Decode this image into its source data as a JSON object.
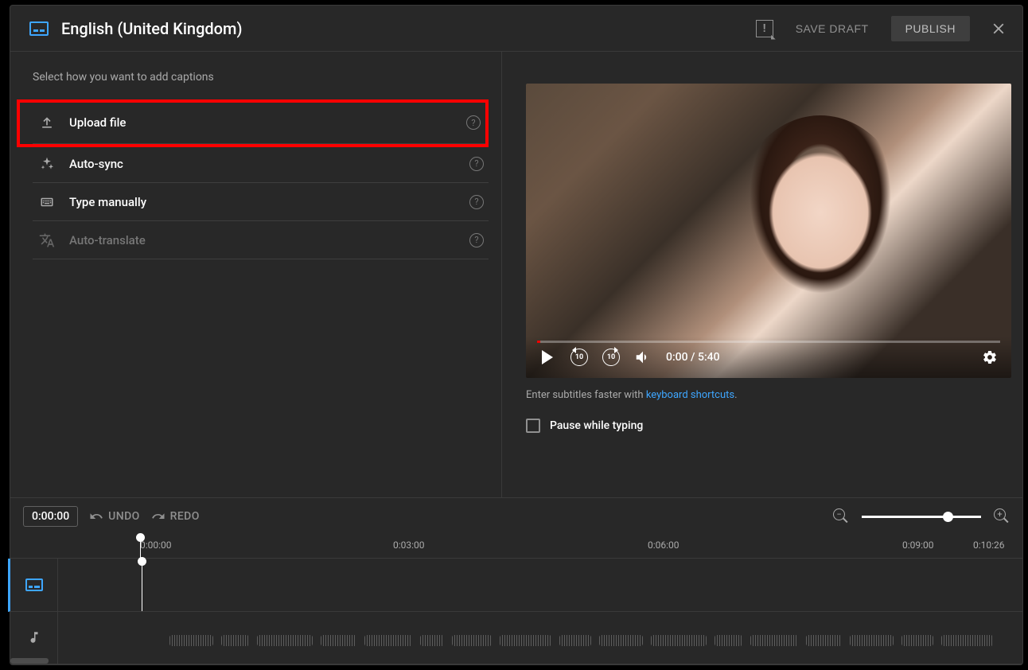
{
  "header": {
    "title": "English (United Kingdom)",
    "save_draft": "SAVE DRAFT",
    "publish": "PUBLISH"
  },
  "left": {
    "hint": "Select how you want to add captions",
    "options": {
      "upload": "Upload file",
      "autosync": "Auto-sync",
      "manual": "Type manually",
      "translate": "Auto-translate"
    }
  },
  "video": {
    "skip_back": "10",
    "skip_fwd": "10",
    "time": "0:00 / 5:40"
  },
  "right": {
    "hint_prefix": "Enter subtitles faster with ",
    "hint_link": "keyboard shortcuts",
    "hint_suffix": ".",
    "pause_label": "Pause while typing"
  },
  "timeline": {
    "current": "0:00:00",
    "undo": "UNDO",
    "redo": "REDO",
    "ticks": [
      "0:00:00",
      "0:03:00",
      "0:06:00",
      "0:09:00",
      "0:10:26"
    ]
  }
}
